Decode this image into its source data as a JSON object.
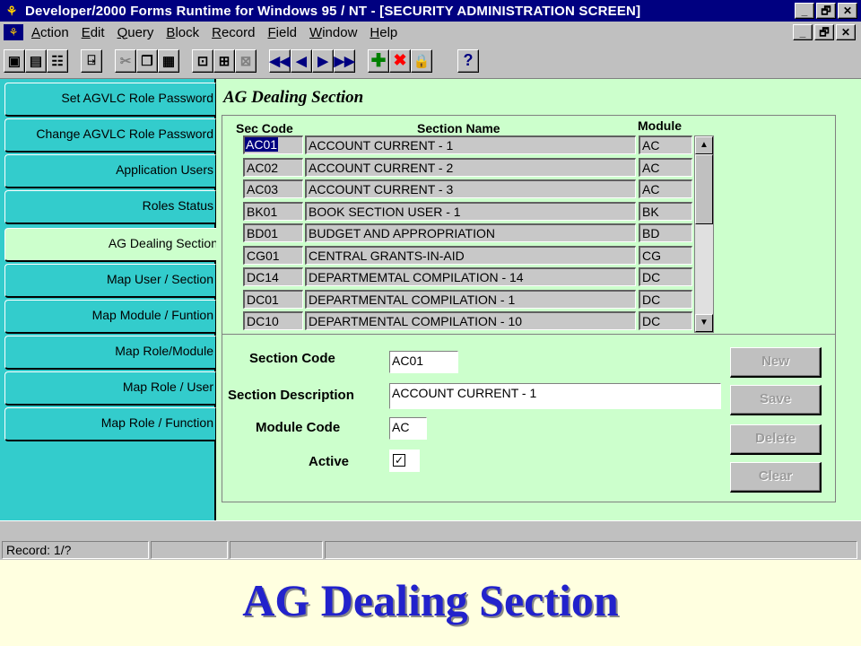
{
  "window": {
    "title": "Developer/2000 Forms Runtime for Windows 95 / NT - [SECURITY ADMINISTRATION SCREEN]",
    "cap_minimize": "_",
    "cap_restore": "🗗",
    "cap_close": "✕"
  },
  "menubar": {
    "items": [
      {
        "underline": "A",
        "rest": "ction"
      },
      {
        "underline": "E",
        "rest": "dit"
      },
      {
        "underline": "Q",
        "rest": "uery"
      },
      {
        "underline": "B",
        "rest": "lock"
      },
      {
        "underline": "R",
        "rest": "ecord"
      },
      {
        "underline": "F",
        "rest": "ield"
      },
      {
        "underline": "W",
        "rest": "indow"
      },
      {
        "underline": "H",
        "rest": "elp"
      }
    ]
  },
  "toolbar": {
    "icons": [
      "save-icon",
      "print-icon",
      "print-setup-icon",
      "exit-icon",
      "cut-icon",
      "copy-icon",
      "paste-icon",
      "enter-query-icon",
      "execute-query-icon",
      "cancel-query-icon",
      "first-record-icon",
      "previous-record-icon",
      "next-record-icon",
      "last-record-icon",
      "insert-record-icon",
      "delete-record-icon",
      "lock-record-icon",
      "help-icon"
    ]
  },
  "sidebar": {
    "tabs": [
      {
        "label": "Set AGVLC Role Password",
        "active": false
      },
      {
        "label": "Change AGVLC Role Password",
        "active": false
      },
      {
        "label": "Application Users",
        "active": false
      },
      {
        "label": "Roles Status",
        "active": false
      },
      {
        "label": "AG Dealing Section",
        "active": true
      },
      {
        "label": "Map User / Section",
        "active": false
      },
      {
        "label": "Map Module / Funtion",
        "active": false
      },
      {
        "label": "Map Role/Module",
        "active": false
      },
      {
        "label": "Map Role / User",
        "active": false
      },
      {
        "label": "Map Role / Function",
        "active": false
      }
    ]
  },
  "main": {
    "title": "AG Dealing Section",
    "grid": {
      "headers": {
        "code": "Sec Code",
        "name": "Section Name",
        "module": "Module"
      },
      "rows": [
        {
          "code": "AC01",
          "name": "ACCOUNT CURRENT - 1",
          "module": "AC"
        },
        {
          "code": "AC02",
          "name": "ACCOUNT CURRENT - 2",
          "module": "AC"
        },
        {
          "code": "AC03",
          "name": "ACCOUNT CURRENT - 3",
          "module": "AC"
        },
        {
          "code": "BK01",
          "name": "BOOK SECTION USER - 1",
          "module": "BK"
        },
        {
          "code": "BD01",
          "name": "BUDGET AND APPROPRIATION",
          "module": "BD"
        },
        {
          "code": "CG01",
          "name": "CENTRAL GRANTS-IN-AID",
          "module": "CG"
        },
        {
          "code": "DC14",
          "name": "DEPARTMEMTAL COMPILATION - 14",
          "module": "DC"
        },
        {
          "code": "DC01",
          "name": "DEPARTMENTAL COMPILATION - 1",
          "module": "DC"
        },
        {
          "code": "DC10",
          "name": "DEPARTMENTAL COMPILATION - 10",
          "module": "DC"
        }
      ],
      "selected_row": 0
    },
    "form": {
      "section_code_label": "Section  Code",
      "section_code_value": "AC01",
      "section_desc_label": "Section Description",
      "section_desc_value": "ACCOUNT CURRENT - 1",
      "module_code_label": "Module Code",
      "module_code_value": "AC",
      "active_label": "Active",
      "active_checked": true,
      "active_mark": "✓"
    },
    "buttons": {
      "new": "New",
      "save": "Save",
      "delete": "Delete",
      "clear": "Clear"
    }
  },
  "statusbar": {
    "record": "Record: 1/?"
  },
  "caption": "AG Dealing Section"
}
